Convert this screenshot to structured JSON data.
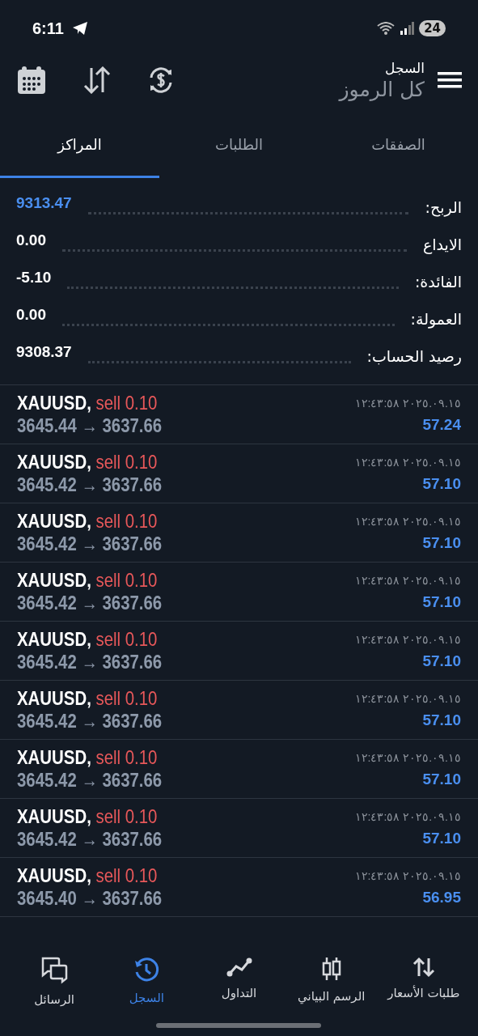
{
  "status_bar": {
    "time": "6:11",
    "battery": "24"
  },
  "header": {
    "title": "السجل",
    "subtitle": "كل الرموز"
  },
  "tabs": [
    {
      "label": "الصفقات",
      "selected": false
    },
    {
      "label": "الطلبات",
      "selected": false
    },
    {
      "label": "المراكز",
      "selected": true
    }
  ],
  "summary": [
    {
      "label": "الربح:",
      "value": "9313.47",
      "highlight": true
    },
    {
      "label": "الايداع",
      "value": "0.00",
      "highlight": false
    },
    {
      "label": "الفائدة:",
      "value": "-5.10",
      "highlight": false
    },
    {
      "label": "العمولة:",
      "value": "0.00",
      "highlight": false
    },
    {
      "label": "رصيد الحساب:",
      "value": "9308.37",
      "highlight": false
    }
  ],
  "trades": [
    {
      "symbol": "XAUUSD,",
      "side": "sell",
      "volume": "0.10",
      "prices": "3645.44 → 3637.66",
      "time": "٢٠٢٥.٠٩.١٥ ١٢:٤٣:٥٨",
      "profit": "57.24"
    },
    {
      "symbol": "XAUUSD,",
      "side": "sell",
      "volume": "0.10",
      "prices": "3645.42 → 3637.66",
      "time": "٢٠٢٥.٠٩.١٥ ١٢:٤٣:٥٨",
      "profit": "57.10"
    },
    {
      "symbol": "XAUUSD,",
      "side": "sell",
      "volume": "0.10",
      "prices": "3645.42 → 3637.66",
      "time": "٢٠٢٥.٠٩.١٥ ١٢:٤٣:٥٨",
      "profit": "57.10"
    },
    {
      "symbol": "XAUUSD,",
      "side": "sell",
      "volume": "0.10",
      "prices": "3645.42 → 3637.66",
      "time": "٢٠٢٥.٠٩.١٥ ١٢:٤٣:٥٨",
      "profit": "57.10"
    },
    {
      "symbol": "XAUUSD,",
      "side": "sell",
      "volume": "0.10",
      "prices": "3645.42 → 3637.66",
      "time": "٢٠٢٥.٠٩.١٥ ١٢:٤٣:٥٨",
      "profit": "57.10"
    },
    {
      "symbol": "XAUUSD,",
      "side": "sell",
      "volume": "0.10",
      "prices": "3645.42 → 3637.66",
      "time": "٢٠٢٥.٠٩.١٥ ١٢:٤٣:٥٨",
      "profit": "57.10"
    },
    {
      "symbol": "XAUUSD,",
      "side": "sell",
      "volume": "0.10",
      "prices": "3645.42 → 3637.66",
      "time": "٢٠٢٥.٠٩.١٥ ١٢:٤٣:٥٨",
      "profit": "57.10"
    },
    {
      "symbol": "XAUUSD,",
      "side": "sell",
      "volume": "0.10",
      "prices": "3645.42 → 3637.66",
      "time": "٢٠٢٥.٠٩.١٥ ١٢:٤٣:٥٨",
      "profit": "57.10"
    },
    {
      "symbol": "XAUUSD,",
      "side": "sell",
      "volume": "0.10",
      "prices": "3645.40 → 3637.66",
      "time": "٢٠٢٥.٠٩.١٥ ١٢:٤٣:٥٨",
      "profit": "56.95"
    }
  ],
  "bottom_nav": [
    {
      "label": "طلبات الأسعار",
      "kind": "quotes",
      "selected": false
    },
    {
      "label": "الرسم البياني",
      "kind": "chart",
      "selected": false
    },
    {
      "label": "التداول",
      "kind": "trade",
      "selected": false
    },
    {
      "label": "السجل",
      "kind": "history",
      "selected": true
    },
    {
      "label": "الرسائل",
      "kind": "messages",
      "selected": false
    }
  ]
}
